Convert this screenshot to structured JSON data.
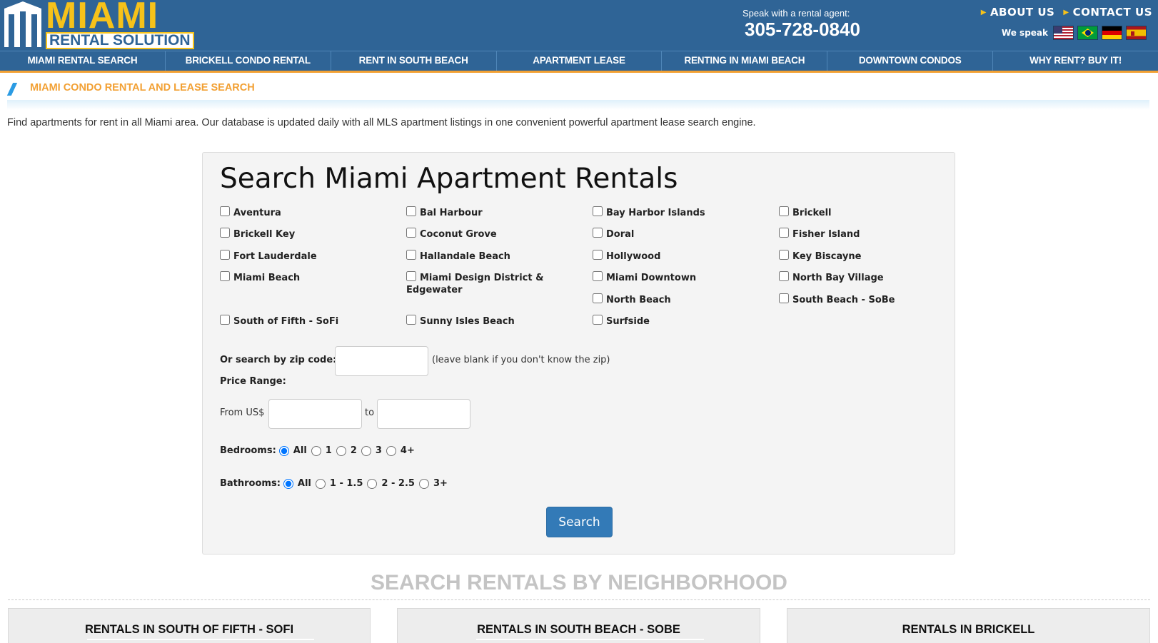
{
  "header": {
    "logo_main": "MIAMI",
    "logo_sub": "RENTAL SOLUTION",
    "agent_label": "Speak with a rental agent:",
    "agent_phone": "305-728-0840",
    "about_label": "ABOUT US",
    "contact_label": "CONTACT US",
    "speak_label": "We speak",
    "flags": [
      "us-flag-icon",
      "brazil-flag-icon",
      "germany-flag-icon",
      "spain-flag-icon"
    ],
    "colors": {
      "bar": "#2f6496",
      "accent": "#f6c21a",
      "orange": "#f2a033"
    }
  },
  "nav": {
    "items": [
      "MIAMI RENTAL SEARCH",
      "BRICKELL CONDO RENTAL",
      "RENT IN SOUTH BEACH",
      "APARTMENT LEASE",
      "RENTING IN MIAMI BEACH",
      "DOWNTOWN CONDOS",
      "WHY RENT? BUY IT!"
    ]
  },
  "page": {
    "title": "MIAMI CONDO RENTAL AND LEASE SEARCH",
    "intro": "Find apartments for rent in all Miami area. Our database is updated daily with all MLS apartment listings in one convenient powerful apartment lease search engine."
  },
  "search": {
    "title": "Search Miami Apartment Rentals",
    "neighborhoods": [
      "Aventura",
      "Bal Harbour",
      "Bay Harbor Islands",
      "Brickell",
      "Brickell Key",
      "Coconut Grove",
      "Doral",
      "Fisher Island",
      "Fort Lauderdale",
      "Hallandale Beach",
      "Hollywood",
      "Key Biscayne",
      "Miami Beach",
      "Miami Design District & Edgewater",
      "Miami Downtown",
      "North Bay Village",
      "North Beach",
      "South Beach - SoBe",
      "South of Fifth - SoFi",
      "Sunny Isles Beach",
      "Surfside"
    ],
    "zip_label": "Or search by zip code:",
    "zip_value": "",
    "zip_note": "(leave blank if you don't know the zip)",
    "price_label": "Price Range:",
    "from_label": "From US$",
    "to_label": "to",
    "price_from": "",
    "price_to": "",
    "bedrooms_label": "Bedrooms:",
    "bedrooms_options": [
      "All",
      "1",
      "2",
      "3",
      "4+"
    ],
    "bedrooms_selected": "All",
    "bathrooms_label": "Bathrooms:",
    "bathrooms_options": [
      "All",
      "1 - 1.5",
      "2 - 2.5",
      "3+"
    ],
    "bathrooms_selected": "All",
    "button_label": "Search"
  },
  "neighborhood_section": {
    "title": "SEARCH RENTALS BY NEIGHBORHOOD",
    "cards": [
      "RENTALS IN SOUTH OF FIFTH - SOFI",
      "RENTALS IN SOUTH BEACH - SOBE",
      "RENTALS IN BRICKELL"
    ]
  }
}
